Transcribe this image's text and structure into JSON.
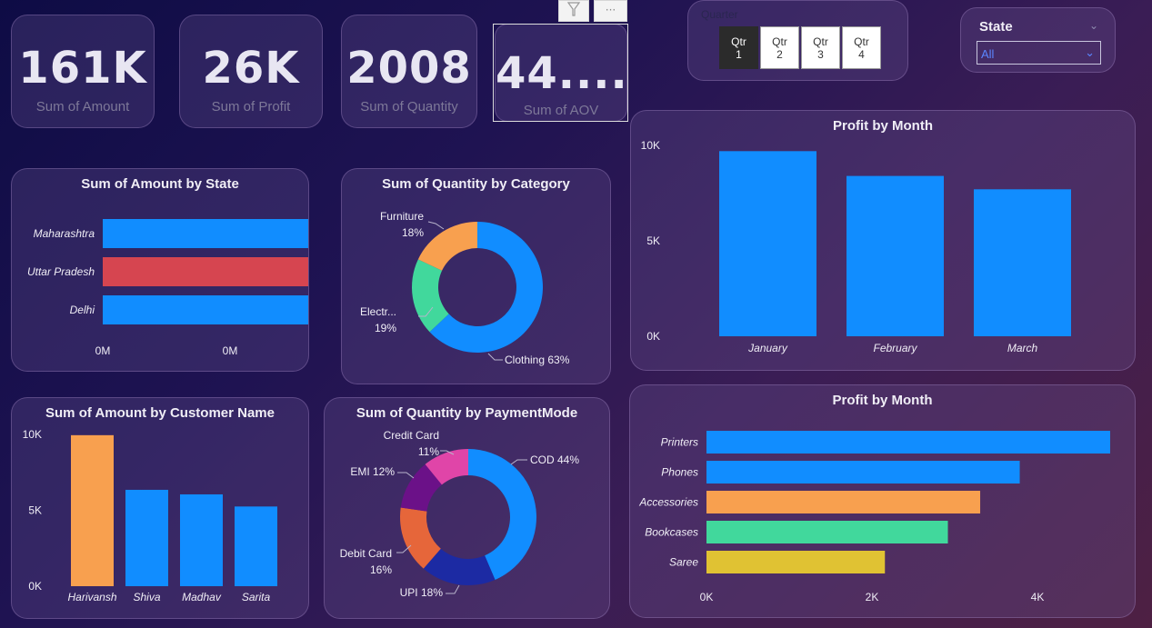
{
  "kpis": [
    {
      "value": "161K",
      "label": "Sum of Amount"
    },
    {
      "value": "26K",
      "label": "Sum of Profit"
    },
    {
      "value": "2008",
      "label": "Sum of Quantity"
    },
    {
      "value": "44....",
      "label": "Sum of AOV"
    }
  ],
  "quarter_slicer": {
    "title": "Quarter",
    "options": [
      {
        "line1": "Qtr",
        "line2": "1",
        "selected": true
      },
      {
        "line1": "Qtr",
        "line2": "2",
        "selected": false
      },
      {
        "line1": "Qtr",
        "line2": "3",
        "selected": false
      },
      {
        "line1": "Qtr",
        "line2": "4",
        "selected": false
      }
    ]
  },
  "state_slicer": {
    "title": "State",
    "selected": "All"
  },
  "visual_toolbar": {
    "more_label": "···"
  },
  "chart_data": [
    {
      "id": "amount_by_state",
      "type": "bar",
      "orientation": "horizontal",
      "title": "Sum of Amount by State",
      "categories": [
        "Maharashtra",
        "Uttar Pradesh",
        "Delhi"
      ],
      "values": [
        0.0215,
        0.0186,
        0.0112
      ],
      "colors": [
        "#118dff",
        "#d64550",
        "#118dff"
      ],
      "x_tick_labels": [
        "0M",
        "0M"
      ]
    },
    {
      "id": "quantity_by_category",
      "type": "pie",
      "donut": true,
      "title": "Sum of Quantity by Category",
      "categories": [
        "Clothing",
        "Electr...",
        "Furniture"
      ],
      "values": [
        63,
        19,
        18
      ],
      "labels": [
        "Clothing 63%",
        "Electr... 19%",
        "Furniture 18%"
      ],
      "colors": [
        "#118dff",
        "#41d89c",
        "#f8a04f"
      ]
    },
    {
      "id": "profit_by_month",
      "type": "bar",
      "orientation": "vertical",
      "title": "Profit by Month",
      "categories": [
        "January",
        "February",
        "March"
      ],
      "values": [
        9700,
        8400,
        7700
      ],
      "ylim": [
        0,
        10000
      ],
      "y_tick_labels": [
        "0K",
        "5K",
        "10K"
      ],
      "colors": [
        "#118dff",
        "#118dff",
        "#118dff"
      ]
    },
    {
      "id": "amount_by_customer",
      "type": "bar",
      "orientation": "vertical",
      "title": "Sum of Amount by Customer Name",
      "categories": [
        "Harivansh",
        "Shiva",
        "Madhav",
        "Sarita"
      ],
      "values": [
        9950,
        6350,
        6050,
        5250
      ],
      "ylim": [
        0,
        10000
      ],
      "y_tick_labels": [
        "0K",
        "5K",
        "10K"
      ],
      "colors": [
        "#f8a04f",
        "#118dff",
        "#118dff",
        "#118dff"
      ]
    },
    {
      "id": "quantity_by_paymentmode",
      "type": "pie",
      "donut": true,
      "title": "Sum of Quantity by PaymentMode",
      "categories": [
        "COD",
        "UPI",
        "Debit Card",
        "EMI",
        "Credit Card"
      ],
      "values": [
        44,
        18,
        16,
        12,
        11
      ],
      "labels": [
        "COD 44%",
        "UPI 18%",
        "Debit Card 16%",
        "EMI 12%",
        "Credit Card 11%"
      ],
      "colors": [
        "#118dff",
        "#1c2aa3",
        "#e6663a",
        "#6b1188",
        "#e045a8"
      ]
    },
    {
      "id": "profit_by_subcategory",
      "type": "bar",
      "orientation": "horizontal",
      "title": "Profit by Month",
      "categories": [
        "Printers",
        "Phones",
        "Accessories",
        "Bookcases",
        "Saree"
      ],
      "values": [
        5000,
        3880,
        3390,
        2990,
        2210
      ],
      "xlim": [
        0,
        5000
      ],
      "x_tick_labels": [
        "0K",
        "2K",
        "4K"
      ],
      "colors": [
        "#118dff",
        "#118dff",
        "#f8a04f",
        "#41d89c",
        "#e0c233"
      ]
    }
  ]
}
